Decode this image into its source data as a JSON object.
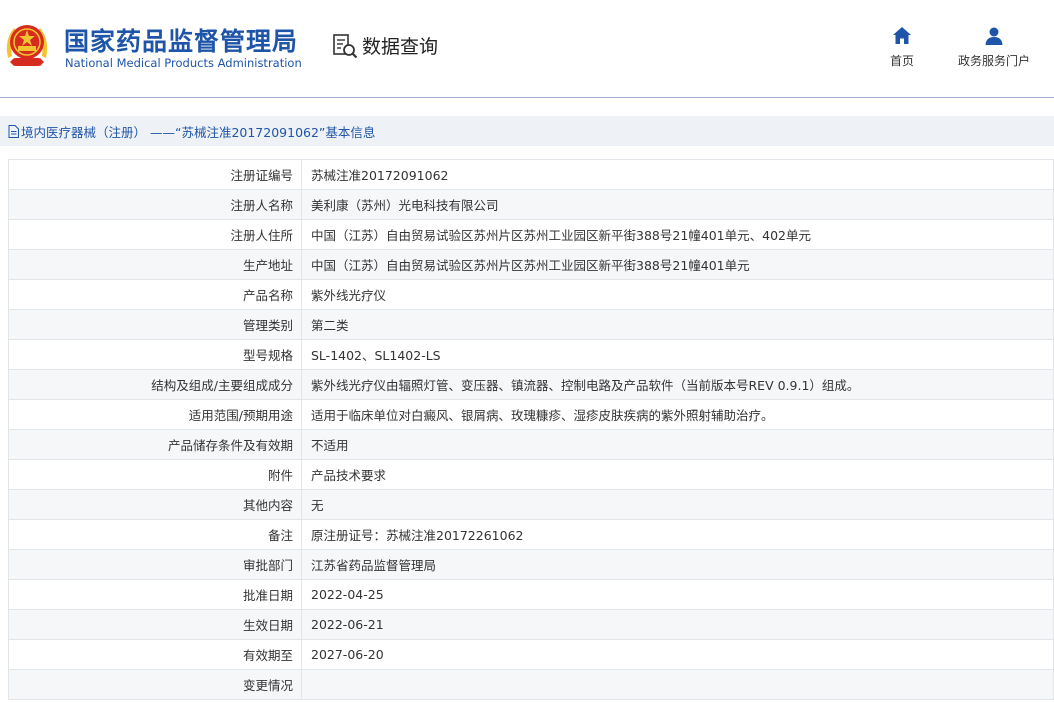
{
  "header": {
    "brand_cn": "国家药品监督管理局",
    "brand_en": "National Medical Products Administration",
    "query_label": "数据查询",
    "nav": [
      {
        "label": "首页",
        "icon": "home-icon"
      },
      {
        "label": "政务服务门户",
        "icon": "user-icon"
      }
    ]
  },
  "colors": {
    "brand_blue": "#1f55a8",
    "emblem_red": "#d62b1f",
    "emblem_gold": "#f4c430"
  },
  "title": "境内医疗器械（注册） ——“苏械注准20172091062”基本信息",
  "rows": [
    {
      "label": "注册证编号",
      "value": "苏械注准20172091062"
    },
    {
      "label": "注册人名称",
      "value": "美利康（苏州）光电科技有限公司"
    },
    {
      "label": "注册人住所",
      "value": "中国（江苏）自由贸易试验区苏州片区苏州工业园区新平街388号21幢401单元、402单元"
    },
    {
      "label": "生产地址",
      "value": "中国（江苏）自由贸易试验区苏州片区苏州工业园区新平街388号21幢401单元"
    },
    {
      "label": "产品名称",
      "value": "紫外线光疗仪"
    },
    {
      "label": "管理类别",
      "value": "第二类"
    },
    {
      "label": "型号规格",
      "value": "SL-1402、SL1402-LS"
    },
    {
      "label": "结构及组成/主要组成成分",
      "value": "紫外线光疗仪由辐照灯管、变压器、镇流器、控制电路及产品软件（当前版本号REV 0.9.1）组成。"
    },
    {
      "label": "适用范围/预期用途",
      "value": "适用于临床单位对白癜风、银屑病、玫瑰糠疹、湿疹皮肤疾病的紫外照射辅助治疗。"
    },
    {
      "label": "产品储存条件及有效期",
      "value": "不适用"
    },
    {
      "label": "附件",
      "value": "产品技术要求"
    },
    {
      "label": "其他内容",
      "value": "无"
    },
    {
      "label": "备注",
      "value": "原注册证号：苏械注准20172261062"
    },
    {
      "label": "审批部门",
      "value": "江苏省药品监督管理局"
    },
    {
      "label": "批准日期",
      "value": "2022-04-25"
    },
    {
      "label": "生效日期",
      "value": "2022-06-21"
    },
    {
      "label": "有效期至",
      "value": "2027-06-20"
    },
    {
      "label": "变更情况",
      "value": ""
    }
  ]
}
